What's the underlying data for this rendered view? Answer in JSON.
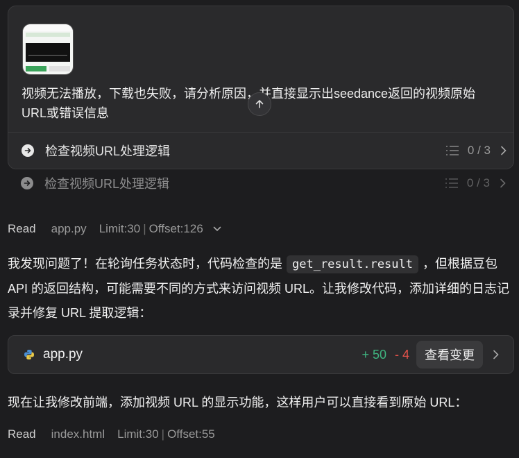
{
  "prompt_card": {
    "message": "视频无法播放，下载也失败，请分析原因，并直接显示出seedance返回的视频原始URL或错误信息",
    "task": {
      "label": "检查视频URL处理逻辑",
      "count": "0 / 3"
    }
  },
  "task_row_2": {
    "label": "检查视频URL处理逻辑",
    "count": "0 / 3"
  },
  "read1": {
    "verb": "Read",
    "file": "app.py",
    "limit": "Limit:30",
    "sep": "|",
    "offset": "Offset:126"
  },
  "para1": {
    "before": "我发现问题了！在轮询任务状态时，代码检查的是",
    "code": "get_result.result",
    "after": "，但根据豆包 API 的返回结构，可能需要不同的方式来访问视频 URL。让我修改代码，添加详细的日志记录并修复 URL 提取逻辑："
  },
  "file_change": {
    "name": "app.py",
    "added": "+ 50",
    "removed": "- 4",
    "view_label": "查看变更"
  },
  "para2": "现在让我修改前端，添加视频 URL 的显示功能，这样用户可以直接看到原始 URL：",
  "read2": {
    "verb": "Read",
    "file": "index.html",
    "limit": "Limit:30",
    "sep": "|",
    "offset": "Offset:55"
  },
  "colors": {
    "accent_add": "#3fb37f",
    "accent_del": "#e5534b",
    "background": "#1d1d1f"
  }
}
